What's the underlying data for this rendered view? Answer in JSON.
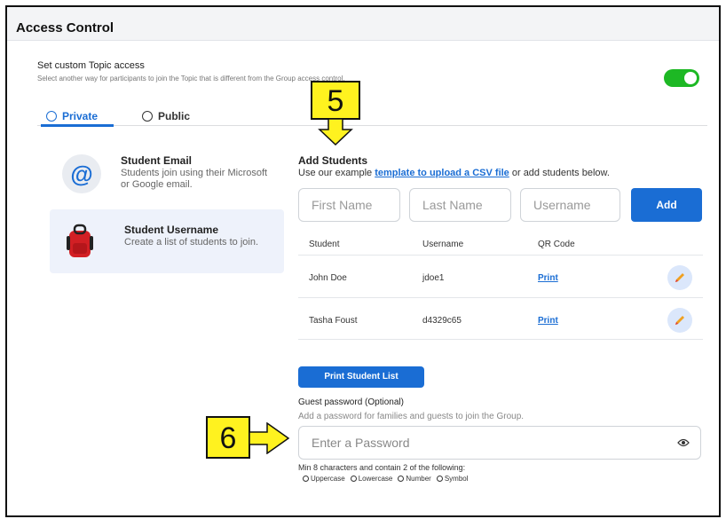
{
  "header": {
    "title": "Access Control"
  },
  "custom_access": {
    "title": "Set custom Topic access",
    "subtitle": "Select another way for participants to join the Topic that is different from the Group access control.",
    "toggle_on": true,
    "toggle_color": "#1db824"
  },
  "tabs": [
    {
      "label": "Private",
      "icon": "lock-check-icon",
      "active": true
    },
    {
      "label": "Public",
      "icon": "globe-icon",
      "active": false
    }
  ],
  "methods": [
    {
      "title": "Student Email",
      "desc": "Students join using their Microsoft or Google email.",
      "icon": "at-sign-icon"
    },
    {
      "title": "Student Username",
      "desc": "Create a list of students to join.",
      "icon": "backpack-icon",
      "selected": true
    }
  ],
  "add_students": {
    "title": "Add Students",
    "desc_prefix": "Use our example ",
    "link": "template to upload a CSV file",
    "desc_suffix": " or add students below.",
    "first_name_placeholder": "First Name",
    "last_name_placeholder": "Last Name",
    "username_placeholder": "Username",
    "add_label": "Add"
  },
  "table": {
    "headers": [
      "Student",
      "Username",
      "QR Code"
    ],
    "rows": [
      {
        "student": "John Doe",
        "username": "jdoe1",
        "qr": "Print"
      },
      {
        "student": "Tasha Foust",
        "username": "d4329c65",
        "qr": "Print"
      }
    ]
  },
  "print_list_label": "Print Student List",
  "guest": {
    "title": "Guest password (Optional)",
    "desc": "Add a password for families and guests to join the Group.",
    "placeholder": "Enter a Password",
    "rule": "Min 8 characters and contain 2 of the following:",
    "options": [
      "Uppercase",
      "Lowercase",
      "Number",
      "Symbol"
    ]
  },
  "callouts": {
    "step5": "5",
    "step6": "6",
    "color": "#fff21f"
  },
  "accent_color": "#1a6dd4"
}
